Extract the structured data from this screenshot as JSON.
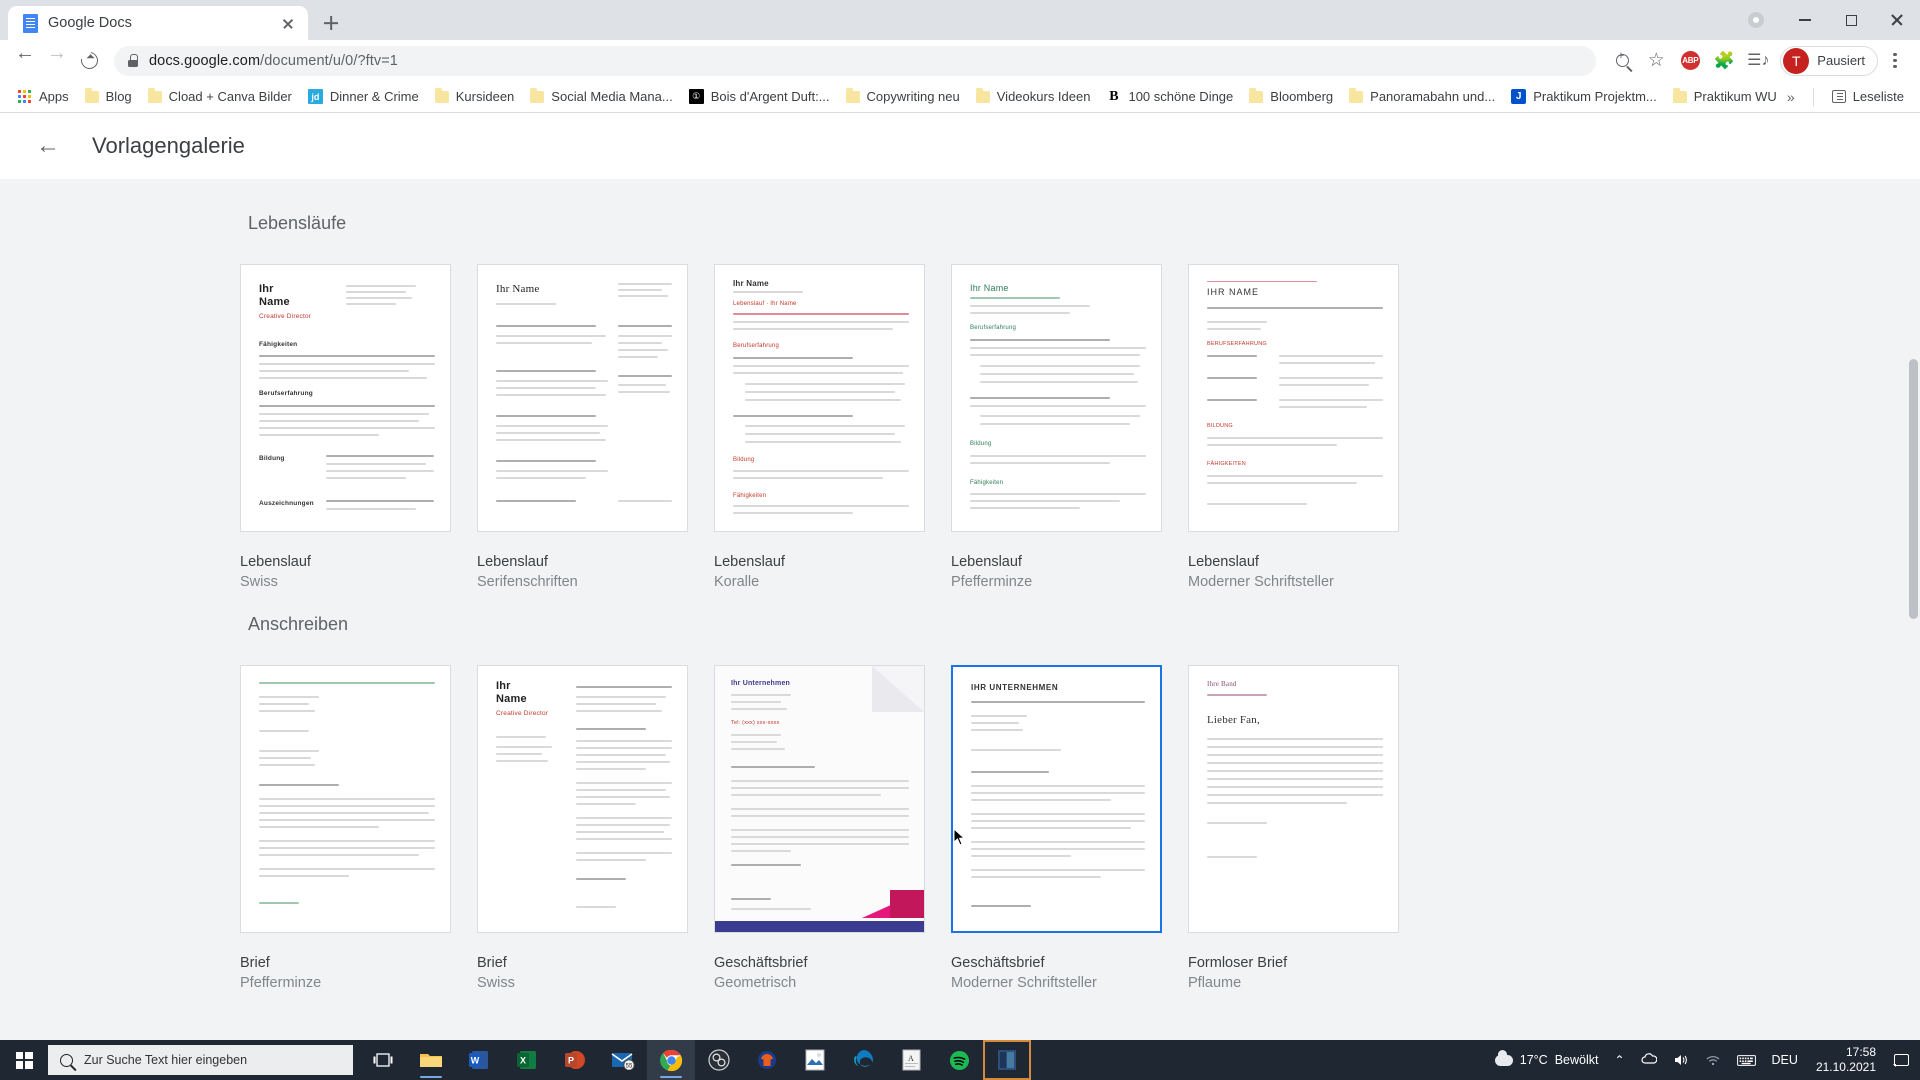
{
  "browser": {
    "tab": {
      "title": "Google Docs",
      "favicon": "google-docs-icon"
    },
    "newtab_label": "+",
    "url_secure": "docs.google.com",
    "url_path": "/document/u/0/?ftv=1",
    "profile_label": "Pausiert",
    "avatar_letter": "T",
    "toolbar_icons": [
      "zoom-icon",
      "bookmark-star-icon",
      "adblock-plus-icon",
      "extensions-puzzle-icon",
      "reading-list-icon"
    ],
    "bookmarks": [
      {
        "label": "Apps",
        "icon": "apps-grid-icon"
      },
      {
        "label": "Blog",
        "icon": "folder-icon"
      },
      {
        "label": "Cload + Canva Bilder",
        "icon": "folder-icon"
      },
      {
        "label": "Dinner & Crime",
        "icon": "jd-favicon"
      },
      {
        "label": "Kursideen",
        "icon": "folder-icon"
      },
      {
        "label": "Social Media Mana...",
        "icon": "folder-icon"
      },
      {
        "label": "Bois d'Argent Duft:...",
        "icon": "dior-favicon"
      },
      {
        "label": "Copywriting neu",
        "icon": "folder-icon"
      },
      {
        "label": "Videokurs Ideen",
        "icon": "folder-icon"
      },
      {
        "label": "100 schöne Dinge",
        "icon": "blogger-favicon"
      },
      {
        "label": "Bloomberg",
        "icon": "folder-icon"
      },
      {
        "label": "Panoramabahn und...",
        "icon": "folder-icon"
      },
      {
        "label": "Praktikum Projektm...",
        "icon": "jira-favicon"
      },
      {
        "label": "Praktikum WU",
        "icon": "folder-icon"
      }
    ],
    "bookmarks_overflow": "»",
    "reading_list_label": "Leseliste"
  },
  "gallery": {
    "title": "Vorlagengalerie",
    "back_icon": "back-arrow-icon",
    "sections": [
      {
        "title": "Lebensläufe",
        "cards": [
          {
            "title": "Lebenslauf",
            "subtitle": "Swiss",
            "style": "swiss",
            "selected": false
          },
          {
            "title": "Lebenslauf",
            "subtitle": "Serifenschriften",
            "style": "serif",
            "selected": false
          },
          {
            "title": "Lebenslauf",
            "subtitle": "Koralle",
            "style": "coral",
            "selected": false
          },
          {
            "title": "Lebenslauf",
            "subtitle": "Pfefferminze",
            "style": "mint",
            "selected": false
          },
          {
            "title": "Lebenslauf",
            "subtitle": "Moderner Schriftsteller",
            "style": "modern",
            "selected": false
          }
        ]
      },
      {
        "title": "Anschreiben",
        "cards": [
          {
            "title": "Brief",
            "subtitle": "Pfefferminze",
            "style": "letter-mint",
            "selected": false
          },
          {
            "title": "Brief",
            "subtitle": "Swiss",
            "style": "letter-swiss",
            "selected": false
          },
          {
            "title": "Geschäftsbrief",
            "subtitle": "Geometrisch",
            "style": "letter-geo",
            "selected": false
          },
          {
            "title": "Geschäftsbrief",
            "subtitle": "Moderner Schriftsteller",
            "style": "letter-modern",
            "selected": true
          },
          {
            "title": "Formloser Brief",
            "subtitle": "Pflaume",
            "style": "letter-plum",
            "selected": false
          }
        ]
      }
    ],
    "thumb_text": {
      "ihr_name": "Ihr Name",
      "ihre_name_lc": "Ihr Name",
      "creative_director": "Creative Director",
      "ihr_unternehmen": "Ihr Unternehmen",
      "ihr_unternehmen_caps": "IHR UNTERNEHMEN",
      "ihr_name_caps": "IHR NAME",
      "lieber_fan": "Lieber Fan,",
      "ihr_band": "Ihre Band"
    }
  },
  "taskbar": {
    "search_placeholder": "Zur Suche Text hier eingeben",
    "start_icon": "windows-start-icon",
    "task_view_icon": "task-view-icon",
    "apps": [
      "file-explorer-icon",
      "word-icon",
      "excel-icon",
      "powerpoint-icon",
      "mail-icon",
      "chrome-icon",
      "obs-icon",
      "audacity-icon",
      "photos-icon",
      "edge-icon",
      "notes-icon",
      "spotify-icon",
      "app-icon"
    ],
    "mail_badge": "55",
    "weather_temp": "17°C",
    "weather_desc": "Bewölkt",
    "language": "DEU",
    "time": "17:58",
    "date": "21.10.2021",
    "tray_icons": [
      "chevron-up-icon",
      "onedrive-icon",
      "volume-icon",
      "wifi-icon",
      "keyboard-icon"
    ],
    "notification_icon": "notification-icon"
  }
}
